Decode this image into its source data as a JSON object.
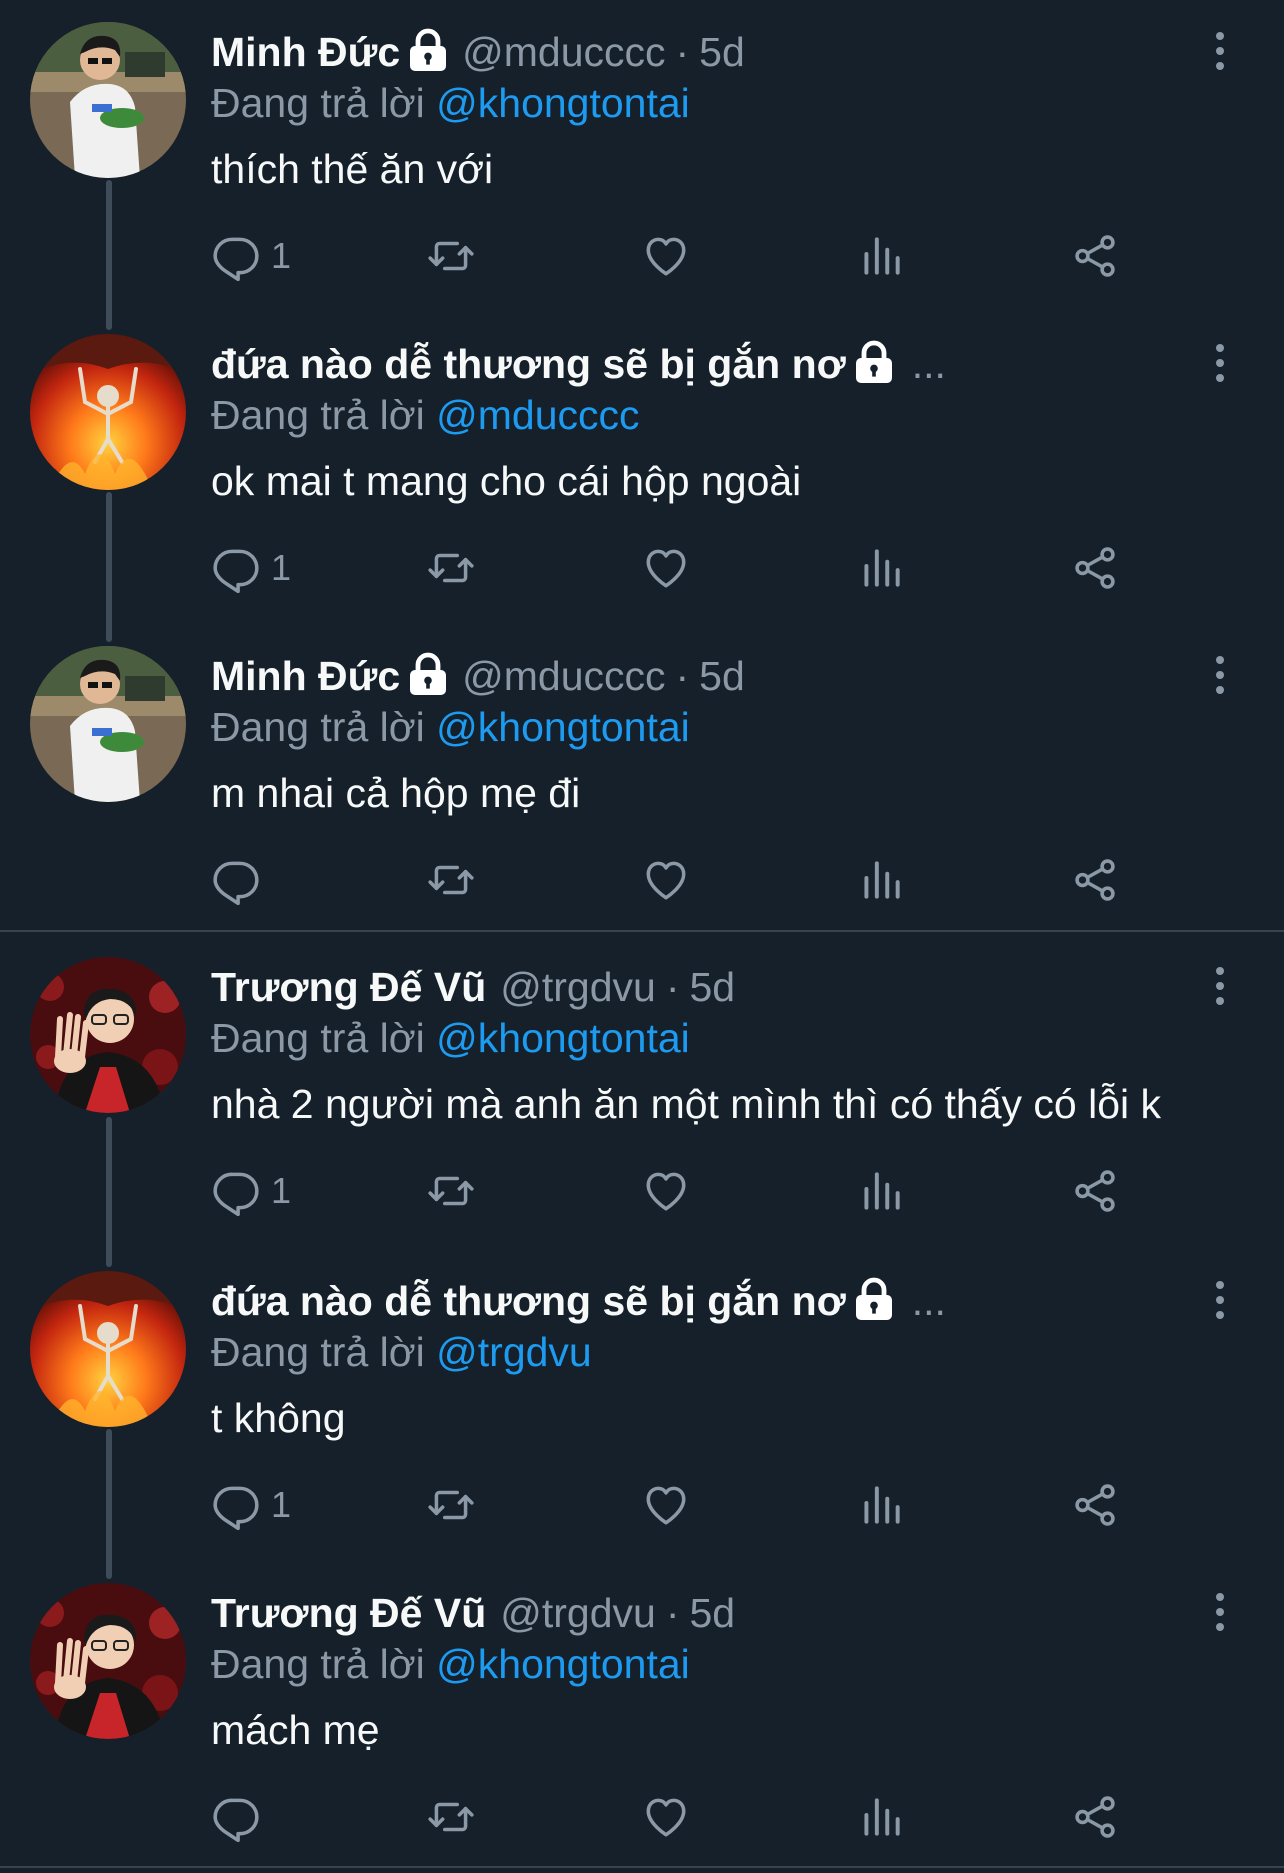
{
  "reply_prefix": "Đang trả lời",
  "icons": {
    "reply": "reply-icon",
    "retweet": "retweet-icon",
    "like": "heart-icon",
    "views": "views-icon",
    "share": "share-icon",
    "lock": "lock-icon",
    "more": "more-icon"
  },
  "colors": {
    "background": "#15202b",
    "text": "#f7f9f9",
    "secondary": "#8b98a5",
    "mention": "#1d9bf0",
    "thread_line": "#3e4c5a"
  },
  "tweets": [
    {
      "name": "Minh Đức",
      "locked": true,
      "handle": "@mducccc",
      "dot": "·",
      "time": "5d",
      "ellipsis": "",
      "reply_to": "@khongtontai",
      "text": "thích thế ăn với",
      "reply_count": "1"
    },
    {
      "name": "đứa nào dễ thương sẽ bị gắn nơ",
      "locked": true,
      "handle": "",
      "dot": "",
      "time": "",
      "ellipsis": "...",
      "reply_to": "@mducccc",
      "text": "ok mai t mang cho cái hộp ngoài",
      "reply_count": "1"
    },
    {
      "name": "Minh Đức",
      "locked": true,
      "handle": "@mducccc",
      "dot": "·",
      "time": "5d",
      "ellipsis": "",
      "reply_to": "@khongtontai",
      "text": "m nhai cả hộp mẹ đi",
      "reply_count": ""
    },
    {
      "name": "Trương Đế Vũ",
      "locked": false,
      "handle": "@trgdvu",
      "dot": "·",
      "time": "5d",
      "ellipsis": "",
      "reply_to": "@khongtontai",
      "text": "nhà 2 người mà anh ăn một mình thì có thấy có lỗi k",
      "reply_count": "1"
    },
    {
      "name": "đứa nào dễ thương sẽ bị gắn nơ",
      "locked": true,
      "handle": "",
      "dot": "",
      "time": "",
      "ellipsis": "...",
      "reply_to": "@trgdvu",
      "text": "t không",
      "reply_count": "1"
    },
    {
      "name": "Trương Đế Vũ",
      "locked": false,
      "handle": "@trgdvu",
      "dot": "·",
      "time": "5d",
      "ellipsis": "",
      "reply_to": "@khongtontai",
      "text": "mách mẹ",
      "reply_count": ""
    }
  ]
}
